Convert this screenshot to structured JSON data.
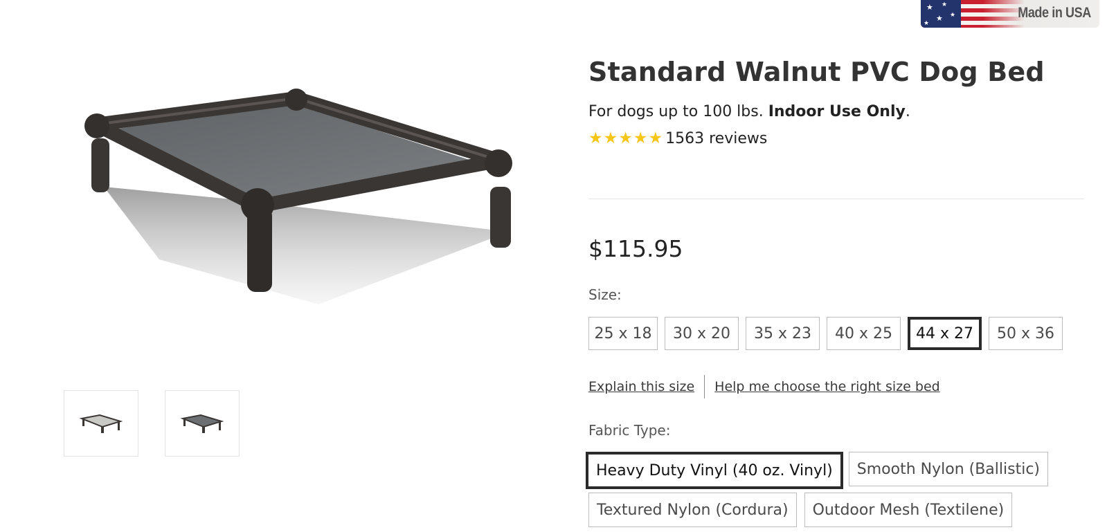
{
  "badge": {
    "text": "Made in USA",
    "icon": "us-flag-icon"
  },
  "product": {
    "title": "Standard Walnut PVC Dog Bed",
    "subtitle_plain": "For dogs up to 100 lbs. ",
    "subtitle_bold": "Indoor Use Only",
    "subtitle_end": ".",
    "rating": 5,
    "rating_max": 5,
    "reviews": "1563 reviews",
    "price": "$115.95"
  },
  "gallery": {
    "main_image": "walnut-pvc-dog-bed-image",
    "thumbnails": [
      "light-bed-thumbnail",
      "dark-bed-thumbnail"
    ]
  },
  "size": {
    "label": "Size:",
    "options": [
      "25 x 18",
      "30 x 20",
      "35 x 23",
      "40 x 25",
      "44 x 27",
      "50 x 36"
    ],
    "selected": "44 x 27"
  },
  "links": {
    "explain": "Explain this size",
    "help": "Help me choose the right size bed"
  },
  "fabric": {
    "label": "Fabric Type:",
    "options": [
      "Heavy Duty Vinyl (40 oz. Vinyl)",
      "Smooth Nylon (Ballistic)",
      "Textured Nylon (Cordura)",
      "Outdoor Mesh (Textilene)"
    ],
    "selected": "Heavy Duty Vinyl (40 oz. Vinyl)"
  },
  "colors": {
    "star": "#f5c518",
    "frame": "#3a3634",
    "fabric": "#6d7073",
    "selected_border": "#2b2b2b"
  }
}
